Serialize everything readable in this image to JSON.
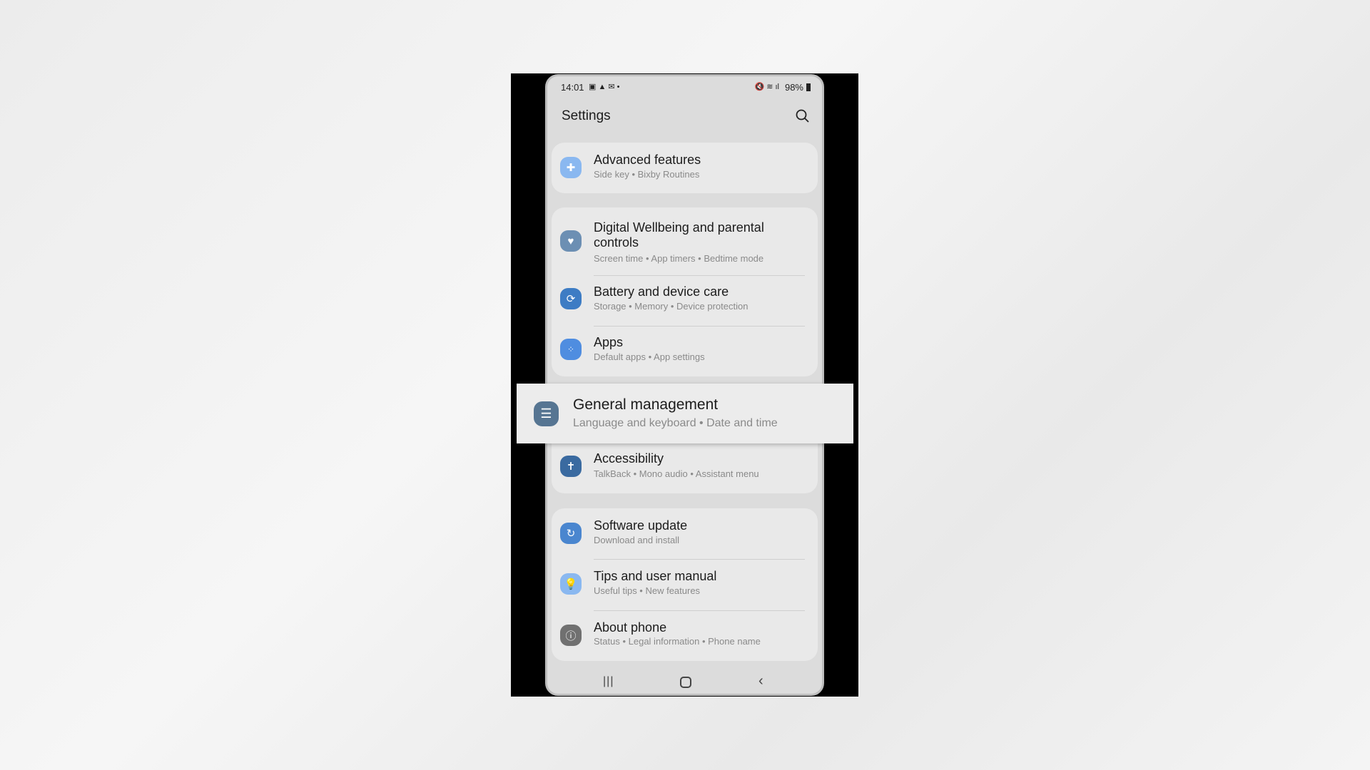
{
  "status": {
    "time": "14:01",
    "battery": "98%"
  },
  "header": {
    "title": "Settings",
    "search_icon": "search-icon"
  },
  "items": [
    {
      "title": "Advanced features",
      "sub": "Side key  •  Bixby Routines",
      "color": "#8ab8f0",
      "icon": "gear-plus-icon"
    },
    {
      "title": "Digital Wellbeing and parental controls",
      "sub": "Screen time  •  App timers  •  Bedtime mode",
      "color": "#6c8fb3",
      "icon": "heart-circle-icon"
    },
    {
      "title": "Battery and device care",
      "sub": "Storage  •  Memory  •  Device protection",
      "color": "#3d7cc4",
      "icon": "refresh-circle-icon"
    },
    {
      "title": "Apps",
      "sub": "Default apps  •  App settings",
      "color": "#4f8de0",
      "icon": "apps-grid-icon"
    },
    {
      "title": "General management",
      "sub": "Language and keyboard  •  Date and time",
      "color": "#567592",
      "icon": "sliders-icon"
    },
    {
      "title": "Accessibility",
      "sub": "TalkBack  •  Mono audio  •  Assistant menu",
      "color": "#3a6aa0",
      "icon": "accessibility-icon"
    },
    {
      "title": "Software update",
      "sub": "Download and install",
      "color": "#4a86cf",
      "icon": "update-icon"
    },
    {
      "title": "Tips and user manual",
      "sub": "Useful tips  •  New features",
      "color": "#8ab8f0",
      "icon": "lightbulb-icon"
    },
    {
      "title": "About phone",
      "sub": "Status  •  Legal information  •  Phone name",
      "color": "#707070",
      "icon": "info-icon"
    }
  ]
}
